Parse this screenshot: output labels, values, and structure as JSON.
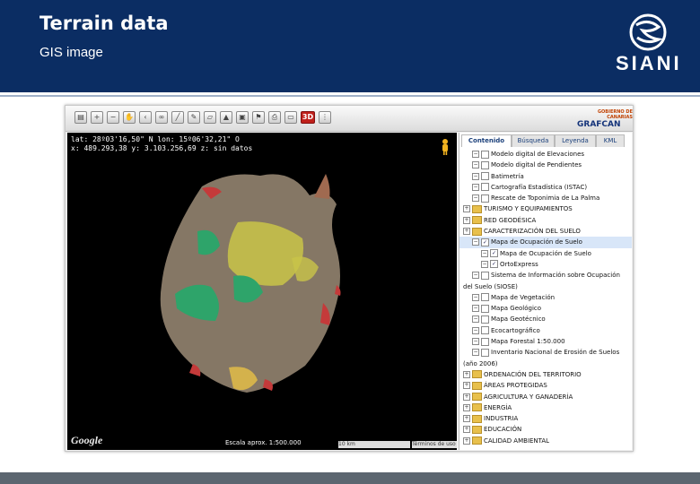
{
  "slide": {
    "title": "Terrain data",
    "subtitle": "GIS image",
    "logo_text": "SIANI"
  },
  "app": {
    "brand": "GRAFCAN",
    "brand_small": "GOBIERNO DE CANARIAS",
    "toolbar_3d": "3D",
    "map": {
      "coords_line1": "lat: 28º03'16,50\" N  lon: 15º06'32,21\" O",
      "coords_line2": "x: 489.293,38  y: 3.103.256,69  z: sin datos",
      "google": "Google",
      "scale": "Escala aprox. 1:500.000",
      "scalebar": "10 km",
      "terms": "Términos de uso"
    },
    "tabs": [
      "Contenido",
      "Búsqueda",
      "Leyenda",
      "KML"
    ],
    "tree": [
      {
        "label": "Modelo digital de Elevaciones",
        "indent": 1,
        "type": "check",
        "checked": false
      },
      {
        "label": "Modelo digital de Pendientes",
        "indent": 1,
        "type": "check",
        "checked": false
      },
      {
        "label": "Batimetría",
        "indent": 1,
        "type": "check",
        "checked": false
      },
      {
        "label": "Cartografía Estadística (ISTAC)",
        "indent": 1,
        "type": "check",
        "checked": false
      },
      {
        "label": "Rescate de Toponimia de La Palma",
        "indent": 1,
        "type": "check",
        "checked": false
      },
      {
        "label": "TURISMO Y EQUIPAMIENTOS",
        "indent": 0,
        "type": "folder"
      },
      {
        "label": "RED GEODÉSICA",
        "indent": 0,
        "type": "folder"
      },
      {
        "label": "CARACTERIZACIÓN DEL SUELO",
        "indent": 0,
        "type": "folder"
      },
      {
        "label": "Mapa de Ocupación de Suelo",
        "indent": 1,
        "type": "check",
        "checked": true,
        "selected": true
      },
      {
        "label": "Mapa de Ocupación de Suelo",
        "indent": 2,
        "type": "check",
        "checked": true
      },
      {
        "label": "OrtoExpress",
        "indent": 2,
        "type": "check",
        "checked": true
      },
      {
        "label": "Sistema de Información sobre Ocupación",
        "indent": 1,
        "type": "check",
        "checked": false
      },
      {
        "label": "del Suelo (SIOSE)",
        "indent": 0,
        "type": "text"
      },
      {
        "label": "Mapa de Vegetación",
        "indent": 1,
        "type": "check",
        "checked": false
      },
      {
        "label": "Mapa Geológico",
        "indent": 1,
        "type": "check",
        "checked": false
      },
      {
        "label": "Mapa Geotécnico",
        "indent": 1,
        "type": "check",
        "checked": false
      },
      {
        "label": "Ecocartográfico",
        "indent": 1,
        "type": "check",
        "checked": false
      },
      {
        "label": "Mapa Forestal 1:50.000",
        "indent": 1,
        "type": "check",
        "checked": false
      },
      {
        "label": "Inventario Nacional de Erosión de Suelos",
        "indent": 1,
        "type": "check",
        "checked": false
      },
      {
        "label": "(año 2006)",
        "indent": 0,
        "type": "text"
      },
      {
        "label": "ORDENACIÓN DEL TERRITORIO",
        "indent": 0,
        "type": "folder"
      },
      {
        "label": "ÁREAS PROTEGIDAS",
        "indent": 0,
        "type": "folder"
      },
      {
        "label": "AGRICULTURA Y GANADERÍA",
        "indent": 0,
        "type": "folder"
      },
      {
        "label": "ENERGÍA",
        "indent": 0,
        "type": "folder"
      },
      {
        "label": "INDUSTRIA",
        "indent": 0,
        "type": "folder"
      },
      {
        "label": "EDUCACIÓN",
        "indent": 0,
        "type": "folder"
      },
      {
        "label": "CALIDAD AMBIENTAL",
        "indent": 0,
        "type": "folder"
      }
    ]
  },
  "colors": {
    "header": "#0b2d63",
    "accent": "#c0201b",
    "footer": "#5c6670"
  }
}
